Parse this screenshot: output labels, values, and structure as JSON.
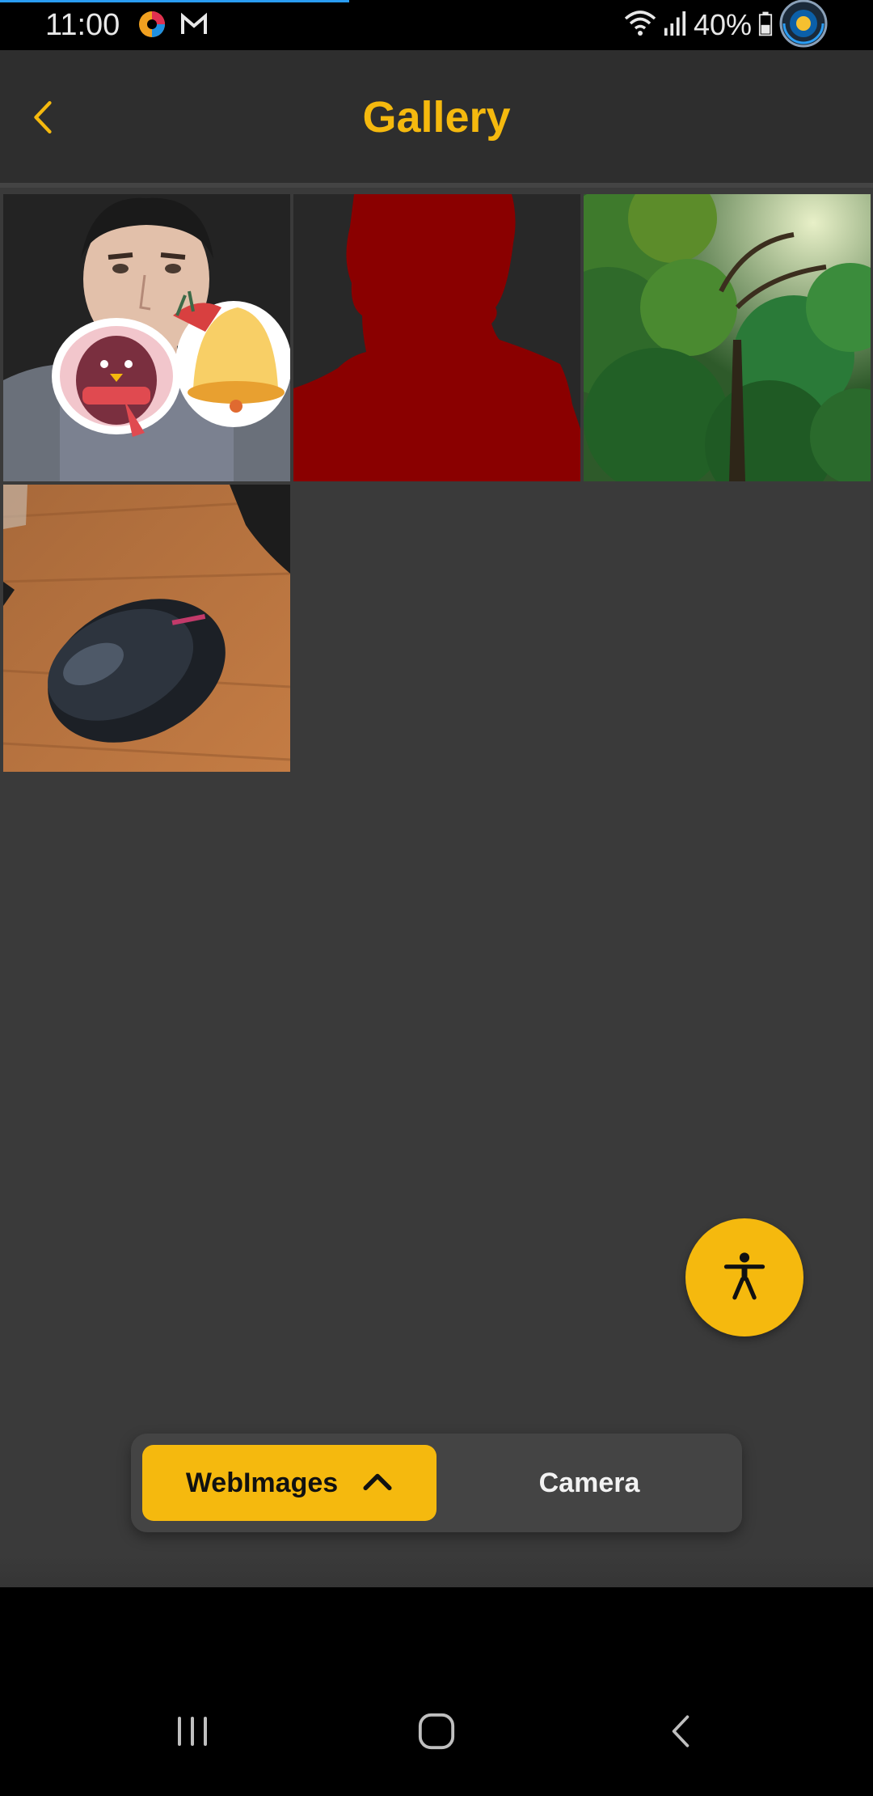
{
  "status_bar": {
    "time": "11:00",
    "battery": "40%",
    "icons": [
      "colorful-app-icon",
      "gmail-icon",
      "wifi-icon",
      "signal-icon",
      "battery-icon",
      "floating-app-icon"
    ]
  },
  "header": {
    "title": "Gallery",
    "back_icon": "chevron-left-icon"
  },
  "gallery": {
    "images": [
      {
        "subject": "man-with-stickers"
      },
      {
        "subject": "red-silhouette"
      },
      {
        "subject": "forest"
      },
      {
        "subject": "computer-mouse"
      }
    ]
  },
  "fab": {
    "icon": "accessibility-icon"
  },
  "source_switch": {
    "active_label": "WebImages",
    "inactive_label": "Camera",
    "active_icon": "chevron-up-icon"
  },
  "nav_bar": {
    "icons": [
      "recent-apps-icon",
      "home-icon",
      "back-icon"
    ]
  },
  "colors": {
    "accent": "#f5b90e",
    "background": "#3a3a3a",
    "header": "#2e2e2e"
  }
}
